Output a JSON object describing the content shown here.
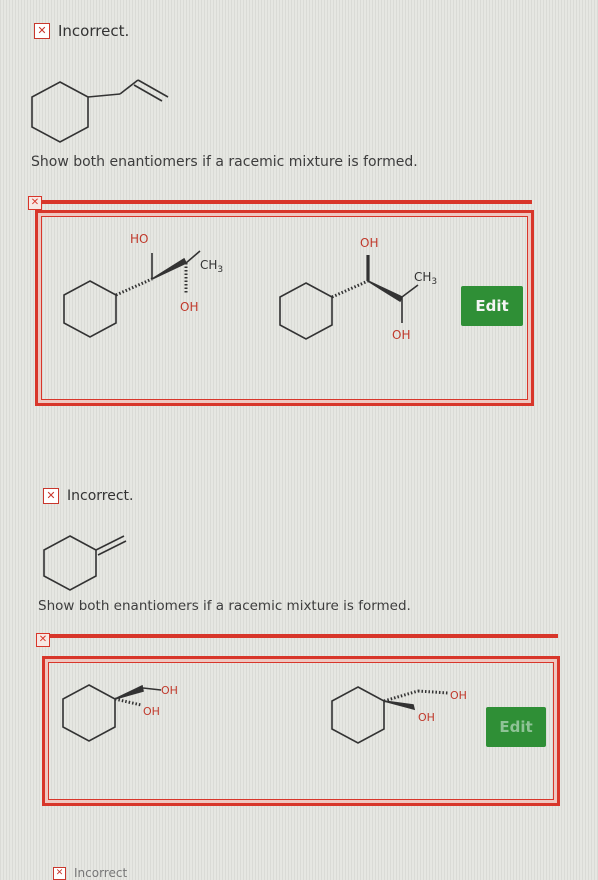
{
  "items": [
    {
      "status": "Incorrect.",
      "prompt": "Show both enantiomers if a racemic mixture is formed.",
      "answer": {
        "left": {
          "label_top": "HO",
          "label_ch3": "CH",
          "label_sub": "3",
          "label_bottom": "OH"
        },
        "right": {
          "label_top": "OH",
          "label_ch3": "CH",
          "label_sub": "3",
          "label_bottom": "OH"
        },
        "edit_label": "Edit"
      }
    },
    {
      "status": "Incorrect.",
      "prompt": "Show both enantiomers if a racemic mixture is formed.",
      "answer": {
        "left": {
          "label_oh1": "OH",
          "label_oh2": "OH"
        },
        "right": {
          "label_oh1": "OH",
          "label_oh2": "OH"
        },
        "edit_label": "Edit"
      }
    },
    {
      "status": "Incorrect"
    }
  ],
  "icons": {
    "status_icon": "close-icon",
    "box_icon": "close-icon"
  },
  "colors": {
    "error_red": "#d8362a",
    "edit_green": "#2f8f36"
  }
}
